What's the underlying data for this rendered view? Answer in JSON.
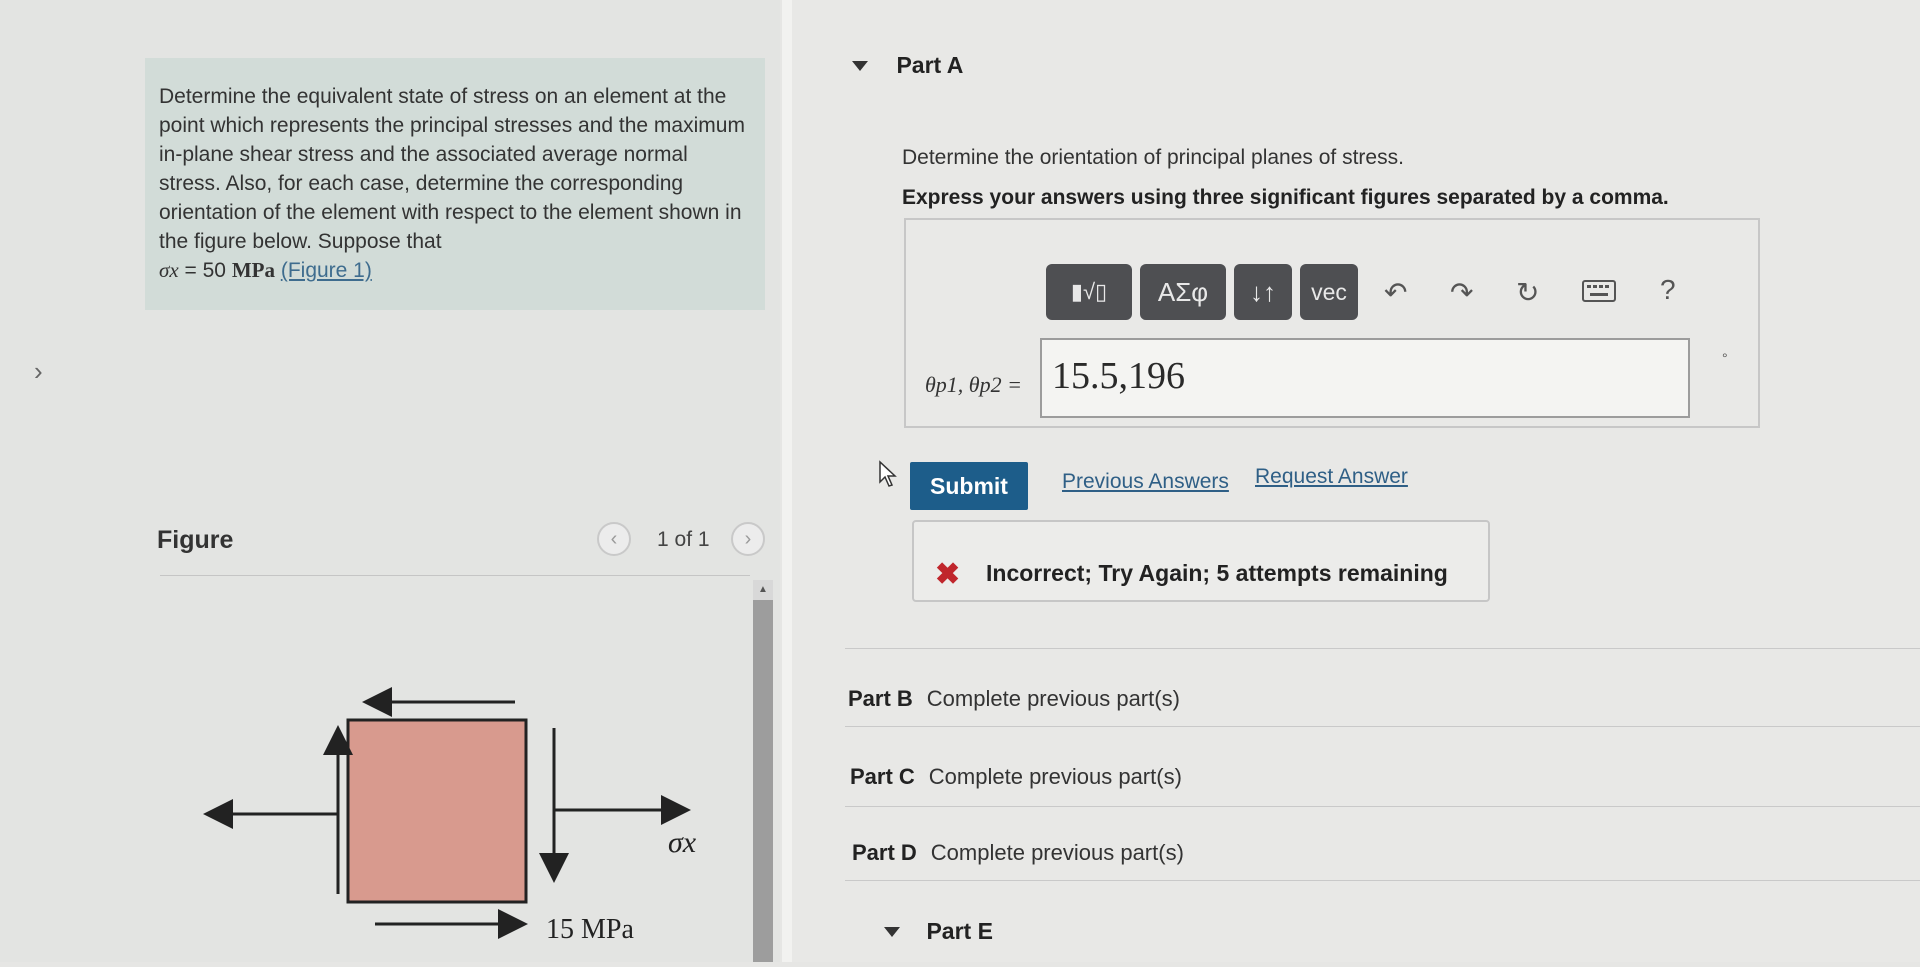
{
  "problem": {
    "text": "Determine the equivalent state of stress on an element at the point which represents the principal stresses and the maximum in-plane shear stress and the associated average normal stress. Also, for each case, determine the corresponding orientation of the element with respect to the element shown in the figure below. Suppose that",
    "sigma_symbol": "σx",
    "sigma_eq": " = 50 ",
    "sigma_unit": "MPa",
    "figure_link": "(Figure 1)"
  },
  "figure": {
    "title": "Figure",
    "pager_text": "1 of 1",
    "prev_icon": "chevron-left-icon",
    "next_icon": "chevron-right-icon",
    "shear_label": "15 MPa",
    "sigma_label": "σx",
    "element_color": "#d89a8e"
  },
  "part_a": {
    "label": "Part A",
    "instruction": "Determine the orientation of principal planes of stress.",
    "express": "Express your answers using three significant figures separated by a comma.",
    "toolbar": {
      "template_label": "▮√▯",
      "greek_label": "ΑΣφ",
      "arrows_label": "↓↑",
      "vec_label": "vec",
      "undo_icon": "undo-icon",
      "redo_icon": "redo-icon",
      "reset_icon": "reset-icon",
      "keyboard_icon": "keyboard-icon",
      "help_label": "?"
    },
    "answer_label": "θp1, θp2 =",
    "answer_value": "15.5,196",
    "unit": "°",
    "submit_label": "Submit",
    "previous_answers": "Previous Answers",
    "request_answer": "Request Answer",
    "feedback": "Incorrect; Try Again; 5 attempts remaining"
  },
  "other_parts": [
    {
      "label": "Part B",
      "status": "Complete previous part(s)"
    },
    {
      "label": "Part C",
      "status": "Complete previous part(s)"
    },
    {
      "label": "Part D",
      "status": "Complete previous part(s)"
    }
  ],
  "part_e": {
    "label": "Part E"
  },
  "colors": {
    "submit": "#1d5d8a",
    "problem_bg": "#d2dcd8",
    "error": "#c0262c",
    "link": "#2f5f86"
  }
}
